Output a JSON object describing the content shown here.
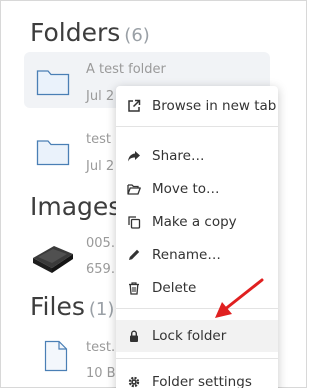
{
  "sections": {
    "folders": {
      "title": "Folders",
      "count": "(6)"
    },
    "images": {
      "title": "Images"
    },
    "files": {
      "title": "Files",
      "count": "(1)"
    }
  },
  "folders": [
    {
      "name": "A test folder",
      "meta": "Jul 2"
    },
    {
      "name": "test",
      "meta": "Jul 2"
    }
  ],
  "images": [
    {
      "name": "005.",
      "meta": "659."
    }
  ],
  "files": [
    {
      "name": "test.",
      "meta": "10 B,"
    }
  ],
  "context_menu": {
    "items": [
      {
        "label": "Browse in new tab",
        "icon": "external-link-icon"
      },
      {
        "label": "Share…",
        "icon": "share-icon"
      },
      {
        "label": "Move to…",
        "icon": "folder-open-icon"
      },
      {
        "label": "Make a copy",
        "icon": "copy-icon"
      },
      {
        "label": "Rename…",
        "icon": "pencil-icon"
      },
      {
        "label": "Delete",
        "icon": "trash-icon"
      },
      {
        "label": "Lock folder",
        "icon": "lock-icon"
      },
      {
        "label": "Folder settings",
        "icon": "gear-icon"
      }
    ]
  },
  "colors": {
    "annotation_arrow": "#e02020",
    "selected_card": "#f1f3f6",
    "folder_icon_stroke": "#4a7fb5",
    "folder_icon_fill": "#eaf2fb"
  }
}
